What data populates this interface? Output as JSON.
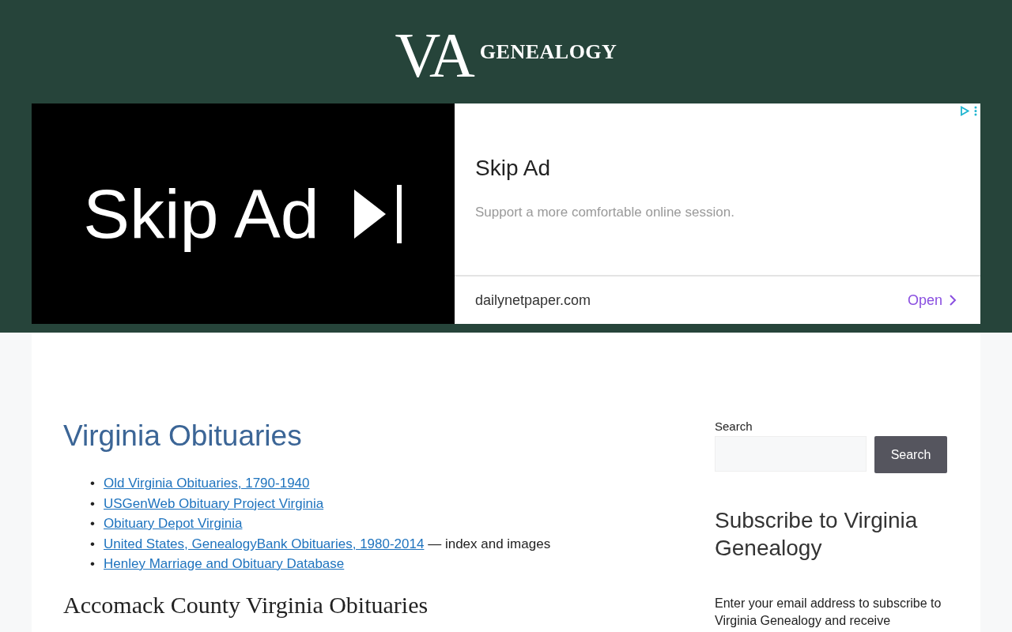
{
  "header": {
    "logo_mark": "VA",
    "logo_text": "GENEALOGY"
  },
  "ad": {
    "banner_text": "Skip Ad",
    "title": "Skip Ad",
    "description": "Support a more comfortable online session.",
    "domain": "dailynetpaper.com",
    "cta": "Open"
  },
  "main": {
    "title": "Virginia Obituaries",
    "links": [
      {
        "marker": "•",
        "link": "Old Virginia Obituaries, 1790-1940"
      },
      {
        "marker": "•",
        "link": "USGenWeb Obituary Project Virginia"
      },
      {
        "marker": "•",
        "link": "Obituary Depot Virginia"
      },
      {
        "marker": "•",
        "link": "United States, GenealogyBank Obituaries, 1980-2014",
        "note": "— index and images"
      },
      {
        "marker": "•",
        "link": "Henley Marriage and Obituary Database"
      }
    ],
    "subheading": "Accomack County Virginia Obituaries"
  },
  "sidebar": {
    "search_label": "Search",
    "search_button": "Search",
    "subscribe_title": "Subscribe to Virginia Genealogy",
    "subscribe_text": "Enter your email address to subscribe to Virginia Genealogy and receive"
  }
}
